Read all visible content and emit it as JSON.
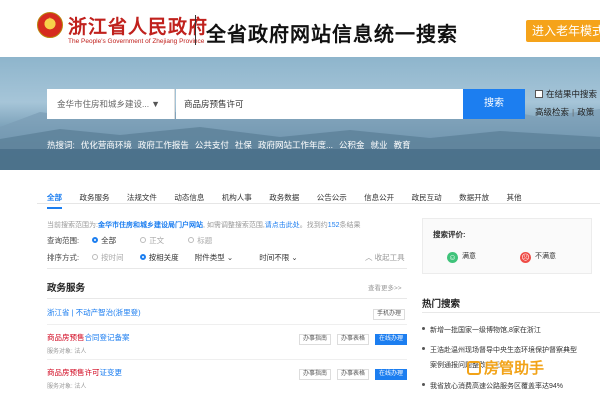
{
  "header": {
    "gov_name": "浙江省人民政府",
    "gov_name_en": "The People's Government of Zhejiang Province",
    "site_title": "全省政府网站信息统一搜索",
    "elder_mode": "进入老年模式"
  },
  "search": {
    "scope": "金华市住房和城乡建设...",
    "query": "商品房预售许可",
    "button": "搜索",
    "in_results": "在结果中搜索",
    "advanced": "高级检索",
    "policy": "政策"
  },
  "hot_words": {
    "label": "热搜词:",
    "items": [
      "优化营商环境",
      "政府工作报告",
      "公共支付",
      "社保",
      "政府网站工作年度...",
      "公积金",
      "就业",
      "教育"
    ]
  },
  "tabs": [
    "全部",
    "政务服务",
    "法规文件",
    "动态信息",
    "机构人事",
    "政务数据",
    "公告公示",
    "信息公开",
    "政民互动",
    "数据开放",
    "其他"
  ],
  "result_info": {
    "prefix": "当前搜索范围为:",
    "dept": "金华市住房和城乡建设局门户网站",
    "mid": ", 如需调整搜索范围,",
    "link": "请点击此处",
    "count_prefix": "。找到约",
    "count": "152",
    "count_suffix": "条结果"
  },
  "filters": {
    "range_label": "查询范围:",
    "range_options": [
      "全部",
      "正文",
      "标题"
    ],
    "sort_label": "排序方式:",
    "sort_options": [
      "按时间",
      "按相关度"
    ],
    "file_type": "附件类型",
    "time_range": "时间不限",
    "collapse": "收起工具"
  },
  "services": {
    "title": "政务服务",
    "more": "查看更多>>",
    "items": [
      {
        "title_plain": "浙江省 | 不动产智治(浙里登)",
        "title_red": "",
        "title_suffix": "",
        "sub": "",
        "buttons": [
          "手机办理"
        ]
      },
      {
        "title_plain": "",
        "title_red": "商品房预售",
        "title_suffix": "合同登记备案",
        "sub": "服务对象: 法人",
        "buttons": [
          "办事指南",
          "办事表格",
          "在线办理"
        ]
      },
      {
        "title_plain": "",
        "title_red": "商品房预售许可",
        "title_suffix": "证变更",
        "sub": "服务对象: 法人",
        "buttons": [
          "办事指南",
          "办事表格",
          "在线办理"
        ]
      }
    ]
  },
  "rating": {
    "title": "搜索评价:",
    "satisfied": "满意",
    "unsatisfied": "不满意"
  },
  "hot_search": {
    "title": "热门搜索",
    "items": [
      "新增一批国家一级博物馆,8家在浙江",
      "王浩赴温州现场督导中央生态环境保护督察典型",
      "案例通报问题整改情况",
      "我省放心消费高速公路服务区覆盖率达94%"
    ]
  },
  "watermark": "房管助手"
}
